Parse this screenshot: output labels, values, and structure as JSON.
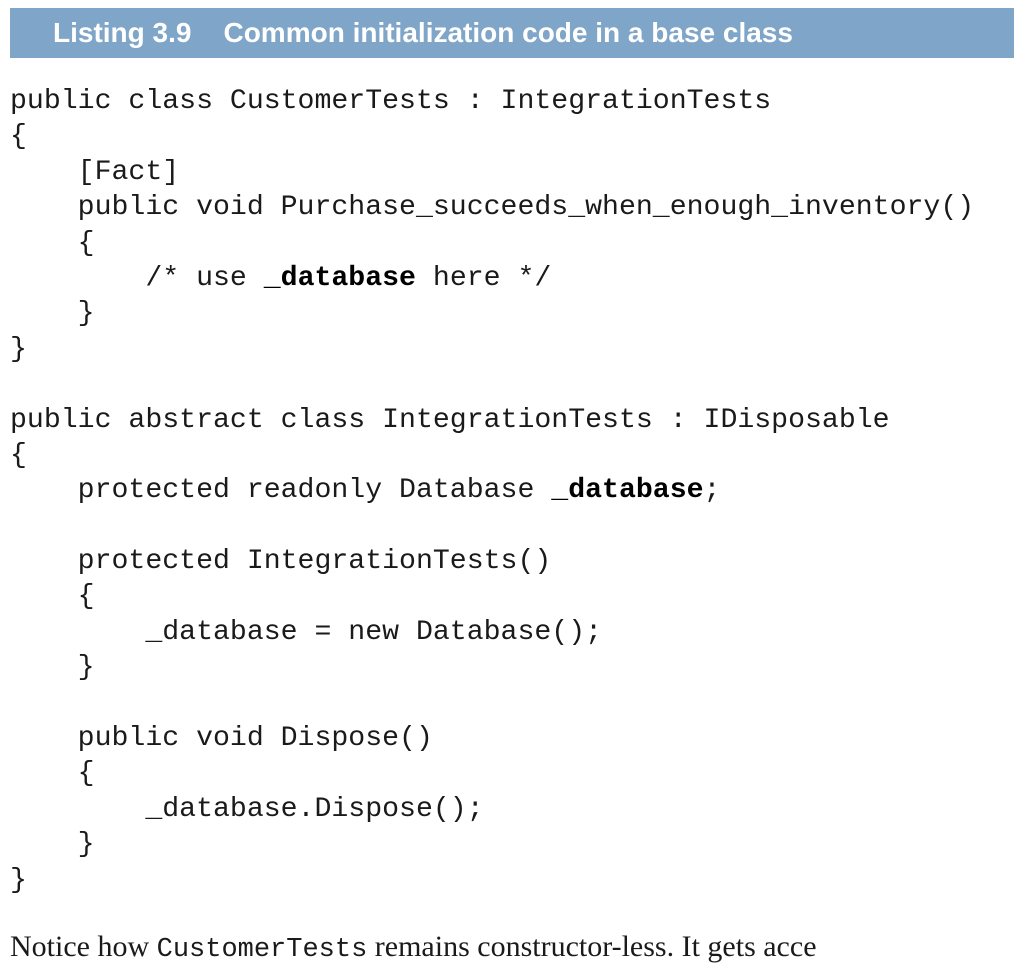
{
  "listing": {
    "label": "Listing 3.9",
    "title": "Common initialization code in a base class"
  },
  "code_lines": [
    [
      {
        "text": "public class CustomerTests : IntegrationTests",
        "bold": false
      }
    ],
    [
      {
        "text": "{",
        "bold": false
      }
    ],
    [
      {
        "text": "    [Fact]",
        "bold": false
      }
    ],
    [
      {
        "text": "    public void Purchase_succeeds_when_enough_inventory()",
        "bold": false
      }
    ],
    [
      {
        "text": "    {",
        "bold": false
      }
    ],
    [
      {
        "text": "        /* use ",
        "bold": false
      },
      {
        "text": "_database",
        "bold": true
      },
      {
        "text": " here */",
        "bold": false
      }
    ],
    [
      {
        "text": "    }",
        "bold": false
      }
    ],
    [
      {
        "text": "}",
        "bold": false
      }
    ],
    [
      {
        "text": "",
        "bold": false
      }
    ],
    [
      {
        "text": "public abstract class IntegrationTests : IDisposable",
        "bold": false
      }
    ],
    [
      {
        "text": "{",
        "bold": false
      }
    ],
    [
      {
        "text": "    protected readonly Database ",
        "bold": false
      },
      {
        "text": "_database",
        "bold": true
      },
      {
        "text": ";",
        "bold": false
      }
    ],
    [
      {
        "text": "",
        "bold": false
      }
    ],
    [
      {
        "text": "    protected IntegrationTests()",
        "bold": false
      }
    ],
    [
      {
        "text": "    {",
        "bold": false
      }
    ],
    [
      {
        "text": "        _database = new Database();",
        "bold": false
      }
    ],
    [
      {
        "text": "    }",
        "bold": false
      }
    ],
    [
      {
        "text": "",
        "bold": false
      }
    ],
    [
      {
        "text": "    public void Dispose()",
        "bold": false
      }
    ],
    [
      {
        "text": "    {",
        "bold": false
      }
    ],
    [
      {
        "text": "        _database.Dispose();",
        "bold": false
      }
    ],
    [
      {
        "text": "    }",
        "bold": false
      }
    ],
    [
      {
        "text": "}",
        "bold": false
      }
    ]
  ],
  "prose": {
    "before": "Notice how ",
    "code": "CustomerTests",
    "after": " remains constructor-less. It gets acce"
  },
  "colors": {
    "header_background": "#7fa5c9",
    "header_text": "#ffffff",
    "body_text": "#1a1a1a"
  }
}
